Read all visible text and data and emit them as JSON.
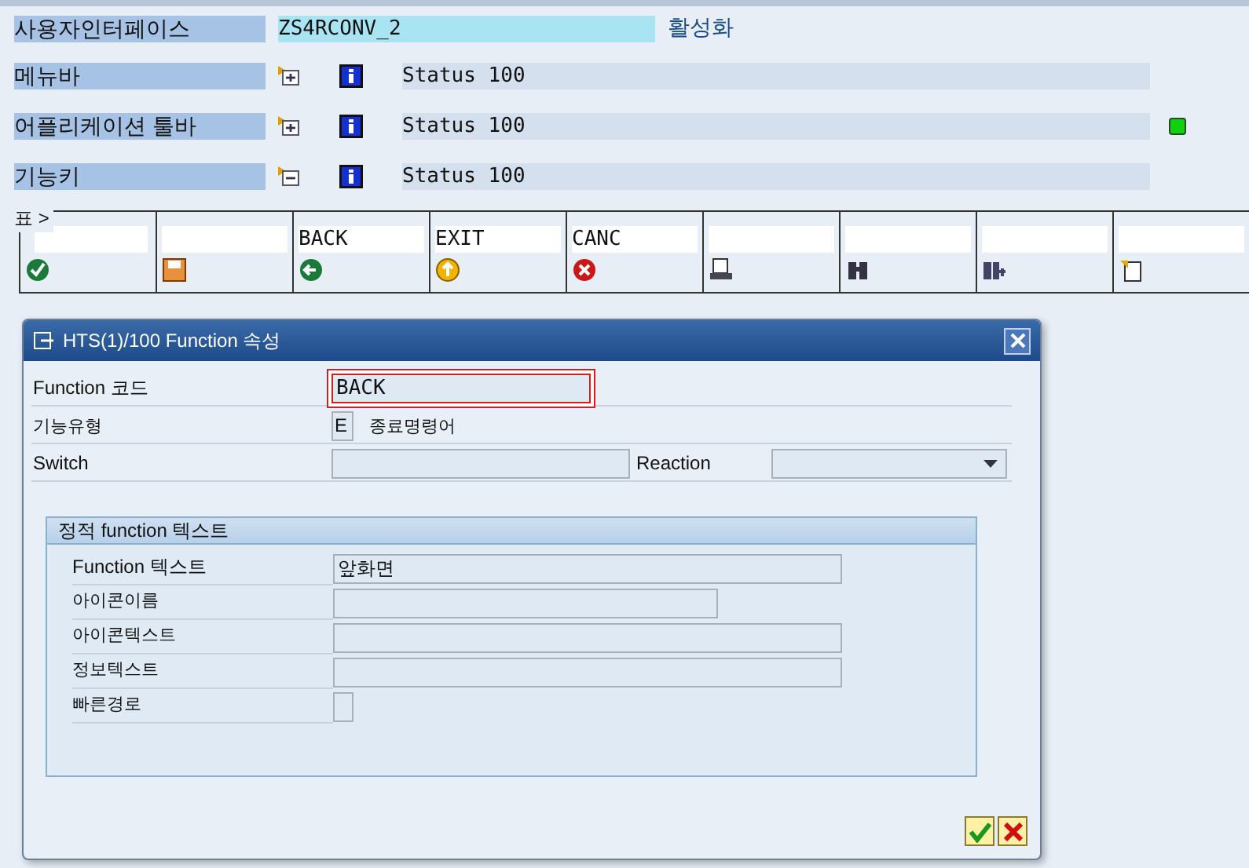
{
  "header": {
    "label": "사용자인터페이스",
    "value": "ZS4RCONV_2",
    "status": "활성화"
  },
  "rows": [
    {
      "label": "메뉴바",
      "kind": "expand",
      "status": "Status 100",
      "light": false
    },
    {
      "label": "어플리케이션 툴바",
      "kind": "expand",
      "status": "Status 100",
      "light": true
    },
    {
      "label": "기능키",
      "kind": "collapse",
      "status": "Status 100",
      "light": false
    }
  ],
  "toolbar": {
    "label": "표 >",
    "buttons": [
      {
        "kind": "check"
      },
      {
        "kind": "save"
      },
      {
        "text": "BACK",
        "kind": "back"
      },
      {
        "text": "EXIT",
        "kind": "exit"
      },
      {
        "text": "CANC",
        "kind": "cancel"
      },
      {
        "kind": "print"
      },
      {
        "kind": "find"
      },
      {
        "kind": "findnext"
      },
      {
        "kind": "page"
      }
    ]
  },
  "dialog": {
    "title": "HTS(1)/100 Function 속성",
    "code": {
      "label": "Function 코드",
      "value": "BACK",
      "focused": true
    },
    "type": {
      "label": "기능유형",
      "value": "E",
      "text": "종료명령어"
    },
    "switch": {
      "label": "Switch"
    },
    "reaction": {
      "label": "Reaction"
    },
    "group": {
      "title": "정적 function 텍스트",
      "fields": [
        {
          "label": "Function 텍스트",
          "value": "앞화면"
        },
        {
          "label": "아이콘이름"
        },
        {
          "label": "아이콘텍스트"
        },
        {
          "label": "정보텍스트"
        },
        {
          "label": "빠른경로"
        }
      ]
    }
  }
}
